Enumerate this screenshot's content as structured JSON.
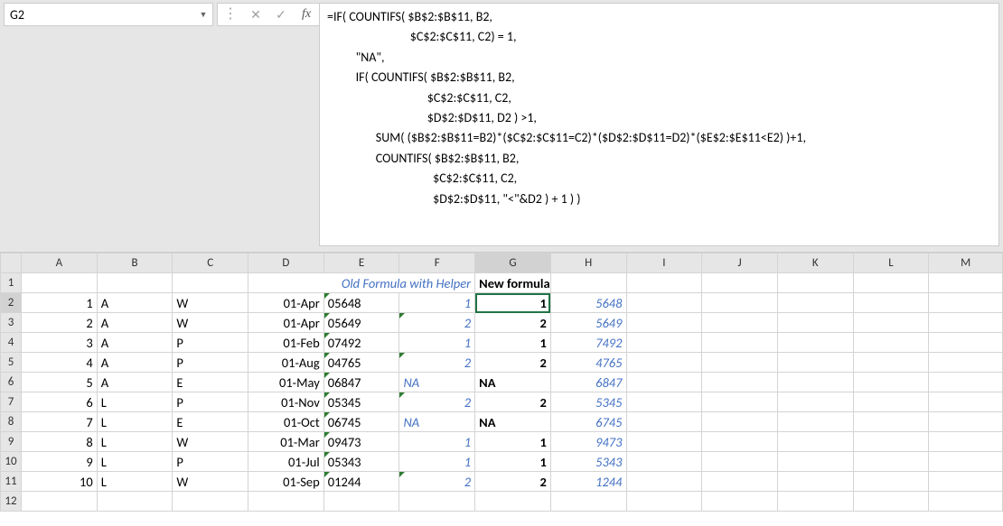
{
  "namebox": {
    "value": "G2"
  },
  "formula_bar": {
    "text": "=IF( COUNTIFS( $B$2:$B$11, B2,\n                             $C$2:$C$11, C2) = 1,\n          \"NA\",\n          IF( COUNTIFS( $B$2:$B$11, B2,\n                                   $C$2:$C$11, C2,\n                                   $D$2:$D$11, D2 ) >1,\n                 SUM( ($B$2:$B$11=B2)*($C$2:$C$11=C2)*($D$2:$D$11=D2)*($E$2:$E$11<E2) )+1,\n                 COUNTIFS( $B$2:$B$11, B2,\n                                     $C$2:$C$11, C2,\n                                     $D$2:$D$11, \"<\"&D2 ) + 1 ) )"
  },
  "columns": [
    "A",
    "B",
    "C",
    "D",
    "E",
    "F",
    "G",
    "H",
    "I",
    "J",
    "K",
    "L",
    "M"
  ],
  "row_numbers": [
    "1",
    "2",
    "3",
    "4",
    "5",
    "6",
    "7",
    "8",
    "9",
    "10",
    "11",
    "12"
  ],
  "selected": {
    "cell": "G2",
    "col": "G",
    "row": "2"
  },
  "headers_row1": {
    "old_formula_header": "Old Formula with Helper",
    "new_formula_header": "New formula"
  },
  "rows": [
    {
      "a": "1",
      "b": "A",
      "c": "W",
      "d": "01-Apr",
      "e": "05648",
      "f": "1",
      "g": "1",
      "h": "5648"
    },
    {
      "a": "2",
      "b": "A",
      "c": "W",
      "d": "01-Apr",
      "e": "05649",
      "f": "2",
      "g": "2",
      "h": "5649"
    },
    {
      "a": "3",
      "b": "A",
      "c": "P",
      "d": "01-Feb",
      "e": "07492",
      "f": "1",
      "g": "1",
      "h": "7492"
    },
    {
      "a": "4",
      "b": "A",
      "c": "P",
      "d": "01-Aug",
      "e": "04765",
      "f": "2",
      "g": "2",
      "h": "4765"
    },
    {
      "a": "5",
      "b": "A",
      "c": "E",
      "d": "01-May",
      "e": "06847",
      "f": "NA",
      "g": "NA",
      "h": "6847"
    },
    {
      "a": "6",
      "b": "L",
      "c": "P",
      "d": "01-Nov",
      "e": "05345",
      "f": "2",
      "g": "2",
      "h": "5345"
    },
    {
      "a": "7",
      "b": "L",
      "c": "E",
      "d": "01-Oct",
      "e": "06745",
      "f": "NA",
      "g": "NA",
      "h": "6745"
    },
    {
      "a": "8",
      "b": "L",
      "c": "W",
      "d": "01-Mar",
      "e": "09473",
      "f": "1",
      "g": "1",
      "h": "9473"
    },
    {
      "a": "9",
      "b": "L",
      "c": "P",
      "d": "01-Jul",
      "e": "05343",
      "f": "1",
      "g": "1",
      "h": "5343"
    },
    {
      "a": "10",
      "b": "L",
      "c": "W",
      "d": "01-Sep",
      "e": "01244",
      "f": "2",
      "g": "2",
      "h": "1244"
    }
  ]
}
